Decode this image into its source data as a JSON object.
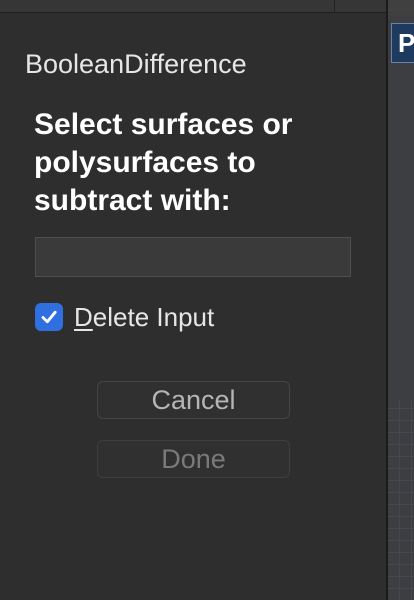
{
  "dialog": {
    "command_name": "BooleanDifference",
    "prompt": "Select surfaces or polysurfaces to subtract with:",
    "input": {
      "value": "",
      "placeholder": ""
    },
    "delete_input": {
      "mnemonic": "D",
      "label_rest": "elete Input",
      "checked": true
    },
    "cancel_label": "Cancel",
    "done_label": "Done"
  },
  "viewport": {
    "tab_letter": "P"
  },
  "colors": {
    "panel_bg": "#2e2e2e",
    "checkbox_accent": "#2f6fe0",
    "text_primary": "#ffffff",
    "viewport_tab": "#1f3a5f"
  }
}
